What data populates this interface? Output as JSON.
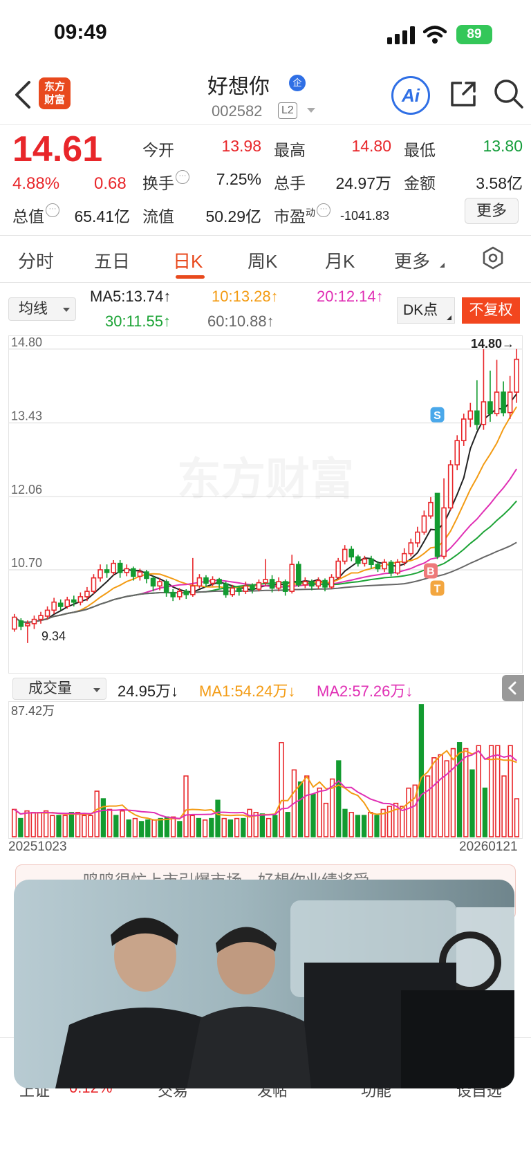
{
  "status": {
    "time": "09:49",
    "battery": "89"
  },
  "header": {
    "name": "好想你",
    "badge": "企",
    "code": "002582",
    "level": "L2",
    "logo_line1": "东方",
    "logo_line2": "财富",
    "ai_label": "Ai"
  },
  "quote": {
    "price": "14.61",
    "change_pct": "4.88%",
    "change_amt": "0.68",
    "rows": [
      [
        {
          "label": "今开",
          "value": "13.98",
          "color": "red"
        },
        {
          "label": "最高",
          "value": "14.80",
          "color": "red"
        },
        {
          "label": "最低",
          "value": "13.80",
          "color": "green"
        }
      ],
      [
        {
          "label": "换手",
          "value": "7.25%",
          "color": "dark"
        },
        {
          "label": "总手",
          "value": "24.97万",
          "color": "dark"
        },
        {
          "label": "金额",
          "value": "3.58亿",
          "color": "dark"
        }
      ],
      [
        {
          "label": "流值",
          "value": "50.29亿",
          "color": "dark"
        },
        {
          "label": "市盈",
          "value": "-1041.83",
          "color": "dark"
        }
      ]
    ],
    "total_value_label": "总值",
    "total_value": "65.41亿",
    "pe_sup": "动",
    "more": "更多"
  },
  "tabs": [
    "分时",
    "五日",
    "日K",
    "周K",
    "月K",
    "更多"
  ],
  "active_tab": 2,
  "ma_legend": {
    "select": "均线",
    "items": [
      {
        "text": "MA5:13.74↑",
        "color": "#222222"
      },
      {
        "text": "10:13.28↑",
        "color": "#f39b13"
      },
      {
        "text": "20:12.14↑",
        "color": "#e02fb4"
      },
      {
        "text": "30:11.55↑",
        "color": "#1ba335"
      },
      {
        "text": "60:10.88↑",
        "color": "#666666"
      }
    ],
    "dk": "DK点",
    "adjust": "不复权"
  },
  "chart_data": {
    "type": "candlestick",
    "ylim": [
      9.3,
      14.9
    ],
    "y_ticks": [
      "14.80",
      "13.43",
      "12.06",
      "10.70"
    ],
    "watermark": "东方财富",
    "high_label": "14.80→",
    "low_label": "9.34",
    "markers": [
      "S",
      "B",
      "T"
    ],
    "x_start": "20251023",
    "x_end": "20260121",
    "candles": [
      [
        9.6,
        9.82,
        9.55,
        9.88
      ],
      [
        9.75,
        9.65,
        9.58,
        9.8
      ],
      [
        9.66,
        9.7,
        9.34,
        9.76
      ],
      [
        9.7,
        9.78,
        9.6,
        9.85
      ],
      [
        9.78,
        9.85,
        9.7,
        9.92
      ],
      [
        9.84,
        9.95,
        9.78,
        10.02
      ],
      [
        9.95,
        10.1,
        9.88,
        10.18
      ],
      [
        10.08,
        10.02,
        9.95,
        10.15
      ],
      [
        10.02,
        10.14,
        9.98,
        10.2
      ],
      [
        10.14,
        10.1,
        10.02,
        10.22
      ],
      [
        10.1,
        10.2,
        10.04,
        10.28
      ],
      [
        10.2,
        10.3,
        10.12,
        10.38
      ],
      [
        10.3,
        10.55,
        10.25,
        10.62
      ],
      [
        10.55,
        10.7,
        10.48,
        10.8
      ],
      [
        10.7,
        10.65,
        10.55,
        10.8
      ],
      [
        10.65,
        10.82,
        10.6,
        10.88
      ],
      [
        10.82,
        10.65,
        10.55,
        10.88
      ],
      [
        10.65,
        10.72,
        10.58,
        10.8
      ],
      [
        10.72,
        10.58,
        10.5,
        10.76
      ],
      [
        10.58,
        10.66,
        10.5,
        10.72
      ],
      [
        10.66,
        10.54,
        10.45,
        10.7
      ],
      [
        10.54,
        10.4,
        10.3,
        10.58
      ],
      [
        10.4,
        10.48,
        10.32,
        10.55
      ],
      [
        10.48,
        10.28,
        10.2,
        10.52
      ],
      [
        10.28,
        10.2,
        10.12,
        10.34
      ],
      [
        10.2,
        10.3,
        10.14,
        10.36
      ],
      [
        10.3,
        10.24,
        10.16,
        10.34
      ],
      [
        10.24,
        10.4,
        10.2,
        10.92
      ],
      [
        10.4,
        10.55,
        10.36,
        10.62
      ],
      [
        10.55,
        10.45,
        10.38,
        10.6
      ],
      [
        10.45,
        10.52,
        10.4,
        10.58
      ],
      [
        10.52,
        10.44,
        10.36,
        10.55
      ],
      [
        10.44,
        10.24,
        10.18,
        10.48
      ],
      [
        10.24,
        10.36,
        10.2,
        10.42
      ],
      [
        10.36,
        10.3,
        10.22,
        10.4
      ],
      [
        10.3,
        10.4,
        10.25,
        10.48
      ],
      [
        10.4,
        10.34,
        10.26,
        10.45
      ],
      [
        10.34,
        10.46,
        10.3,
        10.52
      ],
      [
        10.46,
        10.52,
        10.4,
        10.9
      ],
      [
        10.52,
        10.36,
        10.28,
        10.6
      ],
      [
        10.36,
        10.48,
        10.3,
        10.56
      ],
      [
        10.48,
        10.3,
        10.22,
        10.52
      ],
      [
        10.3,
        10.8,
        10.26,
        10.98
      ],
      [
        10.8,
        10.42,
        10.38,
        10.86
      ],
      [
        10.42,
        10.48,
        10.36,
        10.56
      ],
      [
        10.48,
        10.4,
        10.32,
        10.52
      ],
      [
        10.4,
        10.5,
        10.34,
        10.56
      ],
      [
        10.5,
        10.38,
        10.3,
        10.54
      ],
      [
        10.38,
        10.56,
        10.34,
        10.62
      ],
      [
        10.56,
        10.86,
        10.52,
        10.92
      ],
      [
        10.86,
        11.08,
        10.8,
        11.16
      ],
      [
        11.08,
        10.94,
        10.86,
        11.14
      ],
      [
        10.94,
        10.82,
        10.76,
        10.98
      ],
      [
        10.82,
        10.9,
        10.76,
        10.96
      ],
      [
        10.9,
        10.8,
        10.72,
        10.96
      ],
      [
        10.8,
        10.72,
        10.66,
        10.86
      ],
      [
        10.72,
        10.84,
        10.66,
        10.9
      ],
      [
        10.84,
        10.64,
        10.58,
        10.88
      ],
      [
        10.64,
        10.84,
        10.6,
        10.9
      ],
      [
        10.84,
        11.0,
        10.78,
        11.1
      ],
      [
        11.0,
        11.2,
        10.95,
        11.28
      ],
      [
        11.2,
        11.4,
        11.12,
        11.5
      ],
      [
        11.4,
        11.7,
        11.35,
        11.8
      ],
      [
        11.7,
        11.95,
        11.65,
        12.05
      ],
      [
        12.12,
        10.95,
        10.9,
        12.1
      ],
      [
        10.95,
        11.85,
        10.9,
        12.4
      ],
      [
        11.85,
        12.65,
        11.8,
        12.74
      ],
      [
        12.65,
        13.1,
        12.55,
        13.2
      ],
      [
        13.1,
        13.5,
        13.0,
        13.6
      ],
      [
        13.5,
        13.65,
        13.35,
        13.8
      ],
      [
        13.65,
        13.4,
        13.3,
        14.22
      ],
      [
        13.4,
        13.82,
        13.3,
        14.8
      ],
      [
        13.82,
        13.6,
        13.45,
        14.4
      ],
      [
        13.6,
        14.0,
        13.55,
        14.6
      ],
      [
        14.0,
        13.62,
        13.55,
        14.2
      ],
      [
        13.62,
        14.0,
        13.5,
        14.3
      ],
      [
        14.0,
        14.61,
        13.8,
        14.8
      ]
    ],
    "volume": {
      "ylim": [
        0,
        87.42
      ],
      "y_label": "87.42万",
      "select": "成交量",
      "last": "24.95万↓",
      "ma1": "MA1:54.24万↓",
      "ma2": "MA2:57.26万↓",
      "values": [
        18,
        12,
        17,
        16,
        16,
        17,
        14,
        14,
        14,
        16,
        16,
        14,
        14,
        30,
        25,
        18,
        14,
        17,
        11,
        12,
        10,
        11,
        11,
        12,
        13,
        13,
        10,
        40,
        14,
        12,
        11,
        12,
        24,
        12,
        11,
        12,
        12,
        18,
        16,
        15,
        12,
        14,
        62,
        16,
        44,
        36,
        40,
        28,
        32,
        22,
        38,
        50,
        18,
        16,
        14,
        14,
        16,
        14,
        18,
        20,
        22,
        20,
        32,
        34,
        87,
        40,
        52,
        54,
        50,
        58,
        62,
        58,
        44,
        60,
        32,
        60,
        60,
        40,
        60,
        25
      ]
    }
  },
  "news": {
    "text": "鸣鸣很忙上市引爆市场，好想你业绩将受"
  },
  "bottom_bar": [
    "上证",
    "0.12%",
    "交易",
    "发帖",
    "功能",
    "设自选"
  ]
}
